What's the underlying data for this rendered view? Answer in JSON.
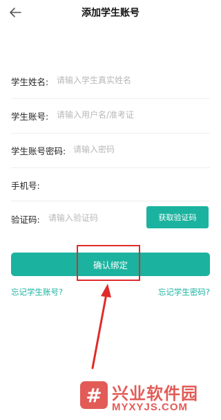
{
  "header": {
    "title": "添加学生账号",
    "back_icon": "back-arrow-icon"
  },
  "form": {
    "name": {
      "label": "学生姓名:",
      "placeholder": "请输入学生真实姓名"
    },
    "account": {
      "label": "学生账号:",
      "placeholder": "请输入用户名/准考证"
    },
    "password": {
      "label": "学生账号密码:",
      "placeholder": "请输入密码"
    },
    "phone": {
      "label": "手机号:",
      "placeholder": ""
    },
    "code": {
      "label": "验证码:",
      "placeholder": "请输入验证码",
      "button_label": "获取验证码"
    }
  },
  "actions": {
    "confirm_label": "确认绑定",
    "forgot_account": "忘记学生账号?",
    "forgot_password": "忘记学生密码?"
  },
  "annotation": {
    "highlight_color": "#e02a2a",
    "arrow_color": "#e02a2a"
  },
  "watermark": {
    "logo_glyph": "#",
    "name": "兴业软件园",
    "domain": "MYXYJS.COM"
  },
  "colors": {
    "accent": "#1bb39f",
    "watermark": "#e25b57"
  }
}
